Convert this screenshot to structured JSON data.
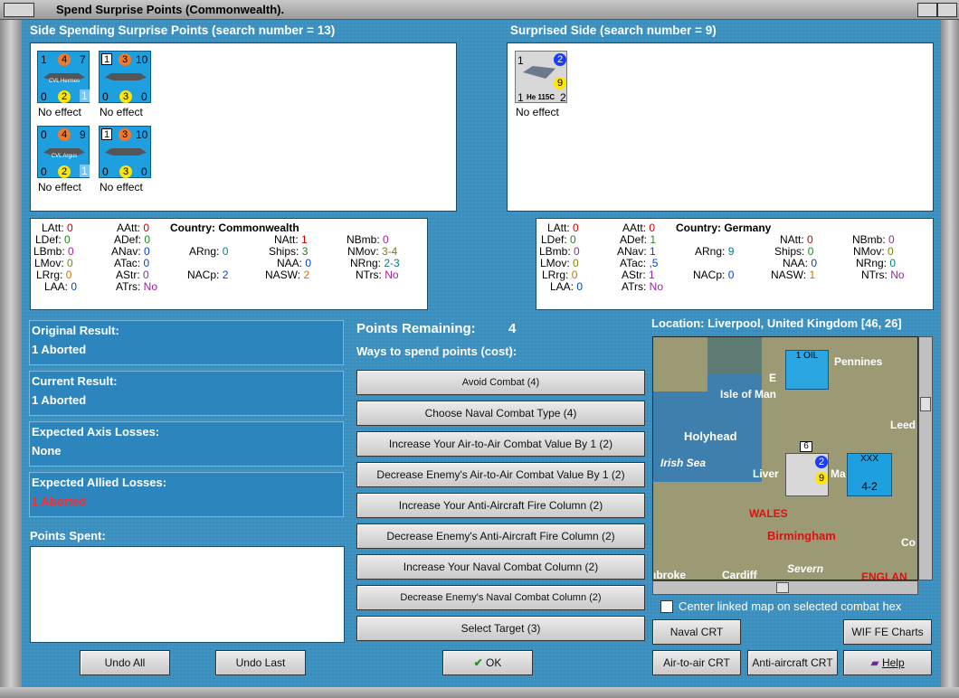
{
  "window": {
    "title": "Spend Surprise Points (Commonwealth)."
  },
  "left_side": {
    "header": "Side Spending Surprise Points (search number = 13)",
    "units": [
      {
        "tl": "1",
        "mid": "4",
        "tr": "7",
        "bl": "0",
        "bm": "2",
        "br": "1",
        "name": "CVL Hermes",
        "effect": "No effect"
      },
      {
        "tl": "1",
        "mid": "3",
        "tr": "10",
        "bl": "0",
        "bm": "3",
        "br": "0",
        "name": "",
        "effect": "No effect"
      },
      {
        "tl": "0",
        "mid": "4",
        "tr": "9",
        "bl": "0",
        "bm": "2",
        "br": "1",
        "name": "CVL Argus",
        "effect": "No effect"
      },
      {
        "tl": "1",
        "mid": "3",
        "tr": "10",
        "bl": "0",
        "bm": "3",
        "br": "0",
        "name": "",
        "effect": "No effect"
      }
    ]
  },
  "right_side": {
    "header": "Surprised Side (search number = 9)",
    "unit": {
      "tl": "1",
      "tr": "2",
      "mid": "9",
      "bl": "1",
      "name": "He 115C",
      "br": "2",
      "effect": "No effect"
    }
  },
  "left_stats": {
    "country": "Country: Commonwealth",
    "LAtt": "0",
    "LDef": "0",
    "LBmb": "0",
    "LMov": "0",
    "LRrg": "0",
    "LAA": "0",
    "AAtt": "0",
    "ADef": "0",
    "ANav": "0",
    "ATac": "0",
    "AStr": "0",
    "ATrs": "No",
    "ARng": "0",
    "NACp": "2",
    "NAtt": "1",
    "Ships": "3",
    "NAA": "0",
    "NASW": "2",
    "NBmb": "0",
    "NMov": "3-4",
    "NRng": "2-3",
    "NTrs": "No"
  },
  "right_stats": {
    "country": "Country: Germany",
    "LAtt": "0",
    "LDef": "0",
    "LBmb": "0",
    "LMov": "0",
    "LRrg": "0",
    "LAA": "0",
    "AAtt": "0",
    "ADef": "1",
    "ANav": "1",
    "ATac": ",5",
    "AStr": "1",
    "ATrs": "No",
    "ARng": "9",
    "NACp": "0",
    "NAtt": "0",
    "Ships": "0",
    "NAA": "0",
    "NASW": "1",
    "NBmb": "0",
    "NMov": "0",
    "NRng": "0",
    "NTrs": "No"
  },
  "stat_labels": {
    "LAtt": "LAtt:",
    "LDef": "LDef:",
    "LBmb": "LBmb:",
    "LMov": "LMov:",
    "LRrg": "LRrg:",
    "LAA": "LAA:",
    "AAtt": "AAtt:",
    "ADef": "ADef:",
    "ANav": "ANav:",
    "ATac": "ATac:",
    "AStr": "AStr:",
    "ATrs": "ATrs:",
    "ARng": "ARng:",
    "NACp": "NACp:",
    "NAtt": "NAtt:",
    "Ships": "Ships:",
    "NAA": "NAA:",
    "NASW": "NASW:",
    "NBmb": "NBmb:",
    "NMov": "NMov:",
    "NRng": "NRng:",
    "NTrs": "NTrs:"
  },
  "results": {
    "original_label": "Original Result:",
    "original_value": "1 Aborted",
    "current_label": "Current Result:",
    "current_value": "1 Aborted",
    "axis_label": "Expected Axis Losses:",
    "axis_value": "None",
    "allied_label": "Expected Allied Losses:",
    "allied_value": "1 Aborted",
    "spent_label": "Points Spent:"
  },
  "points": {
    "remaining_label": "Points Remaining:",
    "remaining_value": "4",
    "ways_label": "Ways to spend points (cost):",
    "options": [
      "Avoid Combat (4)",
      "Choose Naval Combat Type (4)",
      "Increase Your Air-to-Air Combat Value By 1 (2)",
      "Decrease Enemy's Air-to-Air Combat Value By 1 (2)",
      "Increase Your Anti-Aircraft Fire Column (2)",
      "Decrease Enemy's Anti-Aircraft Fire Column (2)",
      "Increase Your Naval Combat Column (2)",
      "Decrease Enemy's Naval Combat Column (2)",
      "Select Target (3)"
    ]
  },
  "location": {
    "label": "Location: Liverpool, United Kingdom [46, 26]"
  },
  "map": {
    "labels": {
      "pennines": "Pennines",
      "isle_of_man": "Isle of Man",
      "holyhead": "Holyhead",
      "irish_sea": "Irish Sea",
      "liverpool": "Liver",
      "manchester": "Ma",
      "wales": "WALES",
      "birmingham": "Birmingham",
      "severn": "Severn",
      "leeds": "Leed",
      "cardiff": "Cardiff",
      "bbroke": "ıbroke",
      "england": "ENGLAN",
      "co": "Co",
      "e": "E"
    },
    "oil_label": "1 OIL",
    "unit_marker": "6",
    "corps": {
      "top": "XXX",
      "val": "4-2"
    }
  },
  "options": {
    "center_linked_label": "Center linked map on selected combat hex"
  },
  "buttons": {
    "undo_all": "Undo All",
    "undo_last": "Undo Last",
    "ok": "OK",
    "naval_crt": "Naval CRT",
    "wif_fe": "WIF FE Charts",
    "air_crt": "Air-to-air CRT",
    "aa_crt": "Anti-aircraft CRT",
    "help": "Help"
  },
  "colors": {
    "panel_bg": "#3b8fbf",
    "result_bg": "#2c86bd",
    "allied_red": "#ff2a2a",
    "counter_blue": "#1e9fe0"
  }
}
